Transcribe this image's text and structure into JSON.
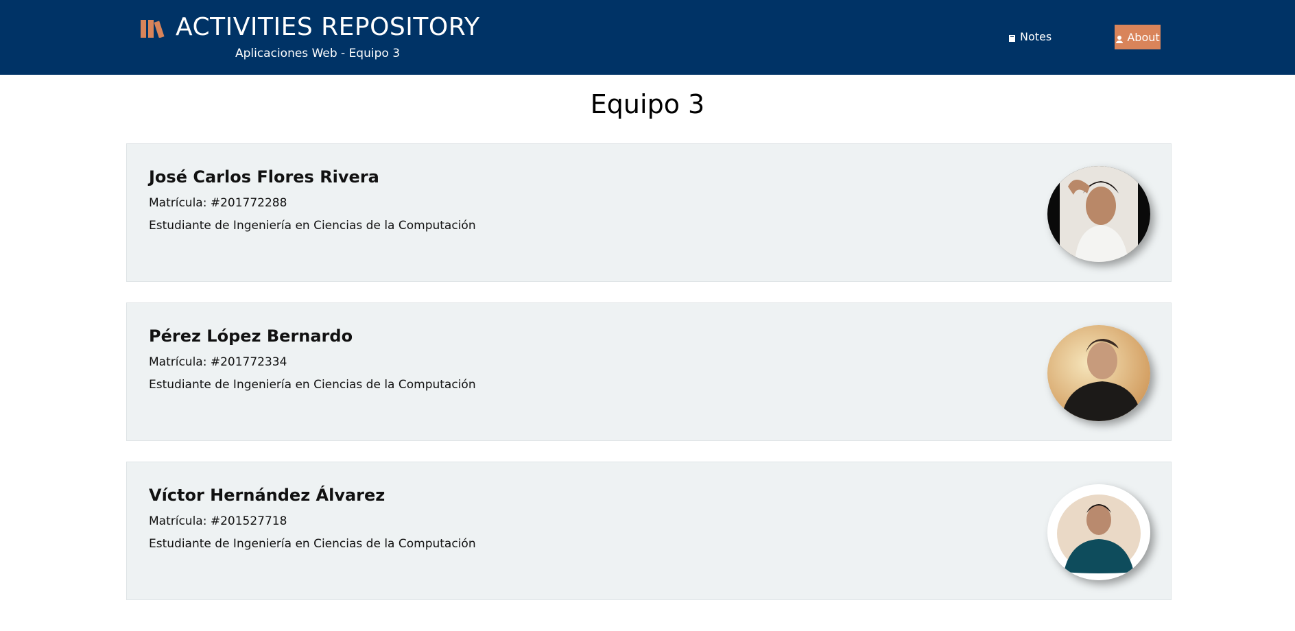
{
  "header": {
    "title": "ACTIVITIES REPOSITORY",
    "subtitle": "Aplicaciones Web - Equipo 3",
    "brand_icon": "books-icon",
    "bg_color": "#003366",
    "accent_color": "#d9845a",
    "nav": {
      "notes_label": "Notes",
      "notes_icon": "book-icon",
      "about_label": "About",
      "about_icon": "user-icon"
    }
  },
  "main": {
    "title": "Equipo 3",
    "members": [
      {
        "name": "José Carlos Flores Rivera",
        "id": "Matrícula: #201772288",
        "description": "Estudiante de Ingeniería en Ciencias de la Computación"
      },
      {
        "name": "Pérez López Bernardo",
        "id": "Matrícula: #201772334",
        "description": "Estudiante de Ingeniería en Ciencias de la Computación"
      },
      {
        "name": "Víctor Hernández Álvarez",
        "id": "Matrícula: #201527718",
        "description": "Estudiante de Ingeniería en Ciencias de la Computación"
      }
    ]
  }
}
